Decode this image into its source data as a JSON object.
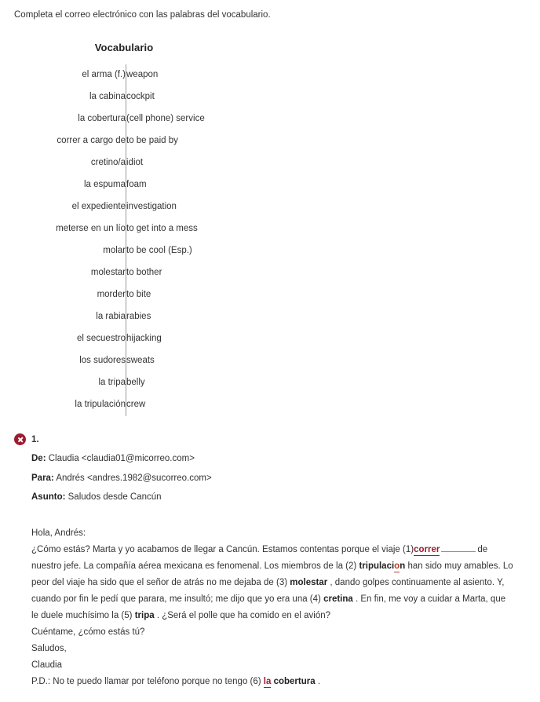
{
  "instruction": "Completa el correo electrónico con las palabras del vocabulario.",
  "vocabulary": {
    "title": "Vocabulario",
    "rows": [
      {
        "term": "el arma (f.)",
        "definition": "weapon"
      },
      {
        "term": "la cabina",
        "definition": "cockpit"
      },
      {
        "term": "la cobertura",
        "definition": "(cell phone) service"
      },
      {
        "term": "correr a cargo de",
        "definition": "to be paid by"
      },
      {
        "term": "cretino/a",
        "definition": "idiot"
      },
      {
        "term": "la espuma",
        "definition": "foam"
      },
      {
        "term": "el expediente",
        "definition": "investigation"
      },
      {
        "term": "meterse en un lío",
        "definition": "to get into a mess"
      },
      {
        "term": "molar",
        "definition": "to be cool (Esp.)"
      },
      {
        "term": "molestar",
        "definition": "to bother"
      },
      {
        "term": "morder",
        "definition": "to bite"
      },
      {
        "term": "la rabia",
        "definition": "rabies"
      },
      {
        "term": "el secuestro",
        "definition": "hijacking"
      },
      {
        "term": "los sudores",
        "definition": "sweats"
      },
      {
        "term": "la tripa",
        "definition": "belly"
      },
      {
        "term": "la tripulación",
        "definition": "crew"
      }
    ]
  },
  "question": {
    "status": "incorrect",
    "number": "1.",
    "email": {
      "from_label": "De:",
      "from_value": "Claudia <claudia01@micorreo.com>",
      "to_label": "Para:",
      "to_value": "Andrés <andres.1982@sucorreo.com>",
      "subject_label": "Asunto:",
      "subject_value": "Saludos desde Cancún",
      "greeting": "Hola, Andrés:",
      "p1_a": "¿Cómo estás? Marta y yo acabamos de llegar a Cancún. Estamos contentas porque el viaje (1)",
      "answer1": "correr",
      "p1_b": "de nuestro jefe. La compañía aérea mexicana es fenomenal. Los miembros de la (2)",
      "answer2_a": "tripulaci",
      "answer2_mark": "o",
      "answer2_b": "n",
      "p2_b": "han sido muy amables. Lo peor del viaje ha sido que el señor de atrás no me dejaba de (3)",
      "answer3": "molestar",
      "p3_b": ", dando golpes continuamente al asiento. Y, cuando por fin le pedí que parara, me insultó; me dijo que yo era una (4)",
      "answer4": "cretina",
      "p4_b": ". En fin, me voy a cuidar a Marta, que le duele muchísimo la (5)",
      "answer5": "tripa",
      "p5_b": ". ¿Será el polle que ha comido en el avión?",
      "closing_question": "Cuéntame, ¿cómo estás tú?",
      "closing_1": "Saludos,",
      "closing_2": "Claudia",
      "ps_a": "P.D.: No te puedo llamar por teléfono porque no tengo (6)",
      "answer6_red": "la",
      "answer6_black": "cobertura",
      "ps_b": "."
    }
  },
  "colors": {
    "error_red": "#9e1b2f",
    "accent_red": "#c0392b",
    "text": "#333333",
    "divider": "#9a9a9a"
  }
}
